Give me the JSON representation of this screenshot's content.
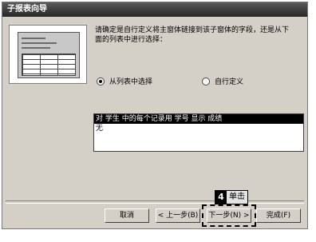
{
  "window": {
    "title": "子报表向导"
  },
  "instruction": "请确定是自行定义将主窗体链接到该子窗体的字段，还是从下\n面的列表中进行选择：",
  "options": [
    {
      "label": "从列表中选择",
      "checked": true
    },
    {
      "label": "自行定义",
      "checked": false
    }
  ],
  "list": {
    "items": [
      {
        "text": "对 学生 中的每个记录用 学号 显示 成绩",
        "selected": true
      },
      {
        "text": "无",
        "selected": false
      }
    ]
  },
  "buttons": {
    "cancel": "取消",
    "back": "< 上一步(B)",
    "next": "下一步(N) >",
    "finish": "完成(F)"
  },
  "annotation": {
    "step": "4",
    "text": "单击"
  }
}
